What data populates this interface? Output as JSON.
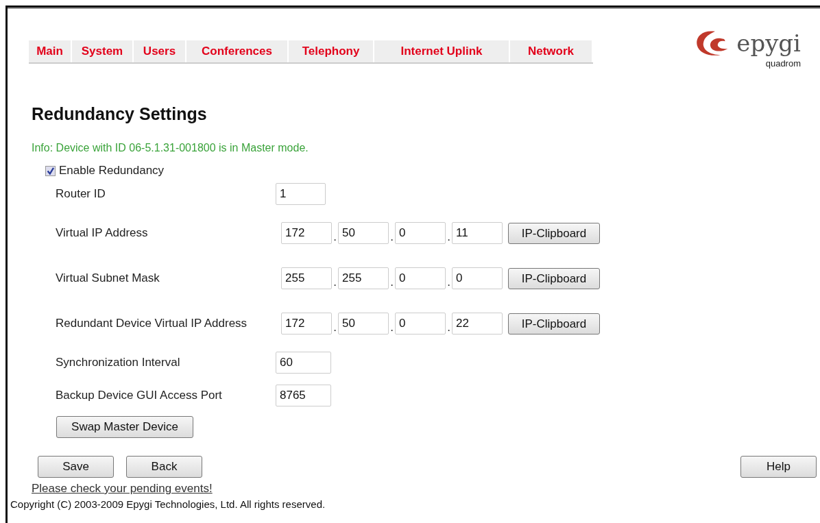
{
  "nav_tabs": [
    {
      "label": "Main"
    },
    {
      "label": "System"
    },
    {
      "label": "Users"
    },
    {
      "label": "Conferences"
    },
    {
      "label": "Telephony"
    },
    {
      "label": "Internet Uplink"
    },
    {
      "label": "Network"
    }
  ],
  "logo": {
    "name": "epygi",
    "subtitle": "quadrom"
  },
  "title": "Redundancy Settings",
  "info": "Info: Device with ID 06-5.1.31-001800 is in Master mode.",
  "enable_redundancy": {
    "label": "Enable Redundancy",
    "checked": true
  },
  "fields": [
    {
      "kind": "single",
      "label": "Router ID",
      "value": "1"
    },
    {
      "kind": "ip",
      "label": "Virtual IP Address",
      "octets": [
        "172",
        "50",
        "0",
        "11"
      ],
      "separator": ".",
      "button": "IP-Clipboard"
    },
    {
      "kind": "ip",
      "label": "Virtual Subnet Mask",
      "octets": [
        "255",
        "255",
        "0",
        "0"
      ],
      "separator": ".",
      "button": "IP-Clipboard"
    },
    {
      "kind": "ip",
      "label": "Redundant Device Virtual IP Address",
      "octets": [
        "172",
        "50",
        "0",
        "22"
      ],
      "separator": ".",
      "button": "IP-Clipboard"
    },
    {
      "kind": "single",
      "label": "Synchronization Interval",
      "value": "60"
    },
    {
      "kind": "single",
      "label": "Backup Device GUI Access Port",
      "value": "8765"
    }
  ],
  "swap_button": "Swap Master Device",
  "buttons": [
    "Save",
    "Back"
  ],
  "help_button": "Help",
  "pending_link": "Please check your pending events!",
  "copyright": "Copyright (C) 2003-2009 Epygi Technologies, Ltd. All rights reserved."
}
